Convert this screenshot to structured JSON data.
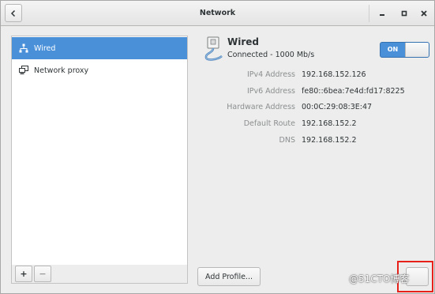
{
  "window": {
    "title": "Network"
  },
  "sidebar": {
    "items": [
      {
        "label": "Wired",
        "icon": "wired-network-icon",
        "selected": true
      },
      {
        "label": "Network proxy",
        "icon": "network-proxy-icon",
        "selected": false
      }
    ],
    "add_label": "+",
    "remove_label": "−"
  },
  "device": {
    "name": "Wired",
    "status": "Connected - 1000 Mb/s",
    "switch_label": "ON",
    "switch_on": true,
    "details": [
      {
        "label": "IPv4 Address",
        "value": "192.168.152.126"
      },
      {
        "label": "IPv6 Address",
        "value": "fe80::6bea:7e4d:fd17:8225"
      },
      {
        "label": "Hardware Address",
        "value": "00:0C:29:08:3E:47"
      },
      {
        "label": "Default Route",
        "value": "192.168.152.2"
      },
      {
        "label": "DNS",
        "value": "192.168.152.2"
      }
    ]
  },
  "footer": {
    "add_profile_label": "Add Profile...",
    "watermark": "@51CTO博客"
  },
  "colors": {
    "accent": "#4a90d9",
    "highlight_box": "#e8201a"
  }
}
